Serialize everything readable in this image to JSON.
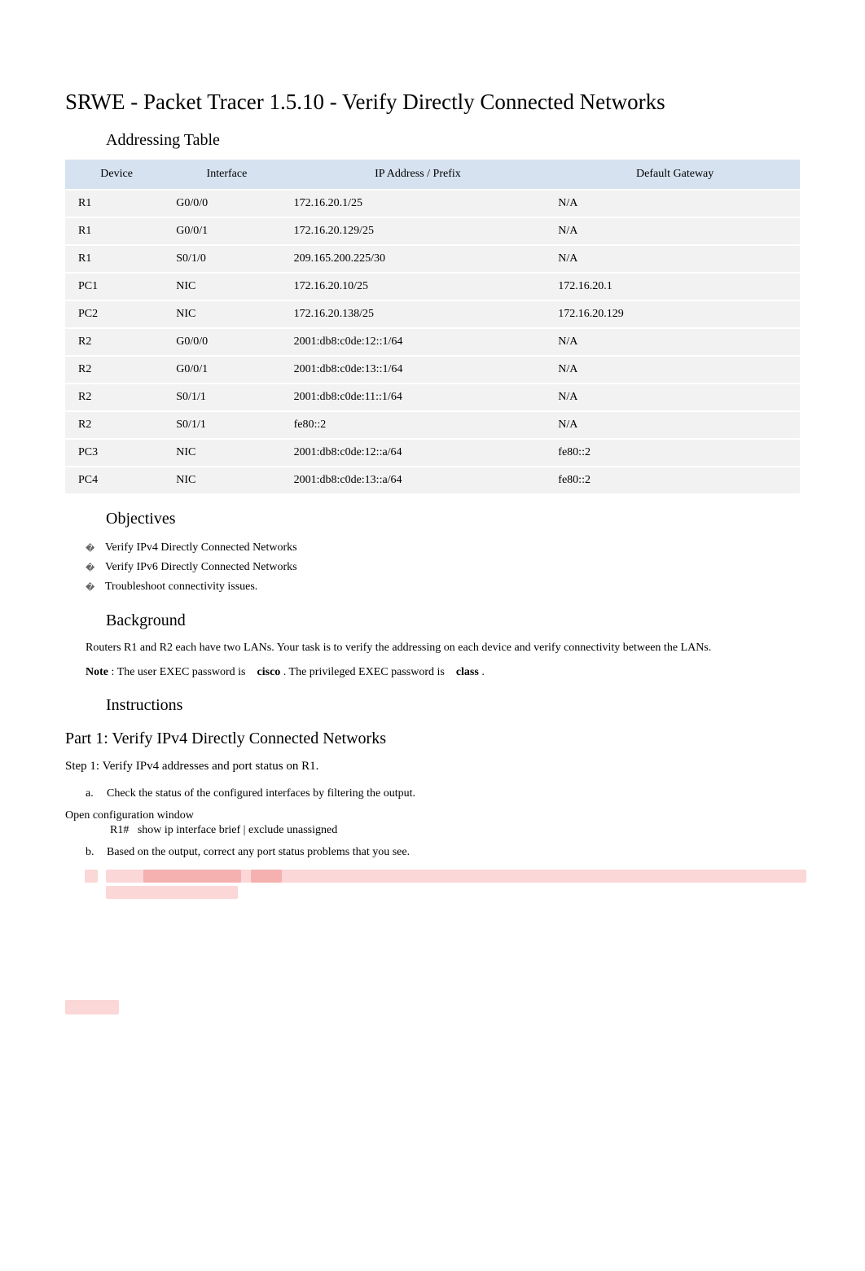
{
  "title": "SRWE - Packet Tracer 1.5.10 - Verify Directly Connected Networks",
  "sections": {
    "addressing_table_title": "Addressing Table",
    "objectives_title": "Objectives",
    "background_title": "Background",
    "instructions_title": "Instructions"
  },
  "table": {
    "headers": {
      "device": "Device",
      "interface": "Interface",
      "ip": "IP Address / Prefix",
      "gateway": "Default Gateway"
    },
    "rows": [
      {
        "device": "R1",
        "interface": "G0/0/0",
        "ip": "172.16.20.1/25",
        "gateway": "N/A"
      },
      {
        "device": "R1",
        "interface": "G0/0/1",
        "ip": "172.16.20.129/25",
        "gateway": "N/A"
      },
      {
        "device": "R1",
        "interface": "S0/1/0",
        "ip": "209.165.200.225/30",
        "gateway": "N/A"
      },
      {
        "device": "PC1",
        "interface": "NIC",
        "ip": "172.16.20.10/25",
        "gateway": "172.16.20.1"
      },
      {
        "device": "PC2",
        "interface": "NIC",
        "ip": "172.16.20.138/25",
        "gateway": "172.16.20.129"
      },
      {
        "device": "R2",
        "interface": "G0/0/0",
        "ip": "2001:db8:c0de:12::1/64",
        "gateway": "N/A"
      },
      {
        "device": "R2",
        "interface": "G0/0/1",
        "ip": "2001:db8:c0de:13::1/64",
        "gateway": "N/A"
      },
      {
        "device": "R2",
        "interface": "S0/1/1",
        "ip": "2001:db8:c0de:11::1/64",
        "gateway": "N/A"
      },
      {
        "device": "R2",
        "interface": "S0/1/1",
        "ip": "fe80::2",
        "gateway": "N/A"
      },
      {
        "device": "PC3",
        "interface": "NIC",
        "ip": "2001:db8:c0de:12::a/64",
        "gateway": "fe80::2"
      },
      {
        "device": "PC4",
        "interface": "NIC",
        "ip": "2001:db8:c0de:13::a/64",
        "gateway": "fe80::2"
      }
    ]
  },
  "objectives": [
    "Verify IPv4 Directly Connected Networks",
    "Verify IPv6 Directly Connected Networks",
    "Troubleshoot connectivity issues."
  ],
  "background_text": "Routers R1 and R2 each have two LANs. Your task is to verify the addressing on each device and verify connectivity between the LANs.",
  "note_prefix": "Note",
  "note_sep": " : ",
  "note_body1": "The user EXEC password is ",
  "note_kw1": "cisco",
  "note_body2": " . The privileged EXEC password is ",
  "note_kw2": "class",
  "note_tail": " .",
  "part1_title": "Part 1: Verify IPv4 Directly Connected Networks",
  "step1_title": "Step 1: Verify IPv4 addresses and port status on R1.",
  "step1_items": {
    "a": "Check the status of the configured interfaces by filtering the output.",
    "b": "Based on the output, correct any port status problems that you see."
  },
  "config_label": "Open configuration window",
  "cmd_prompt": "R1#",
  "cmd_text": "show ip interface brief | exclude unassigned"
}
